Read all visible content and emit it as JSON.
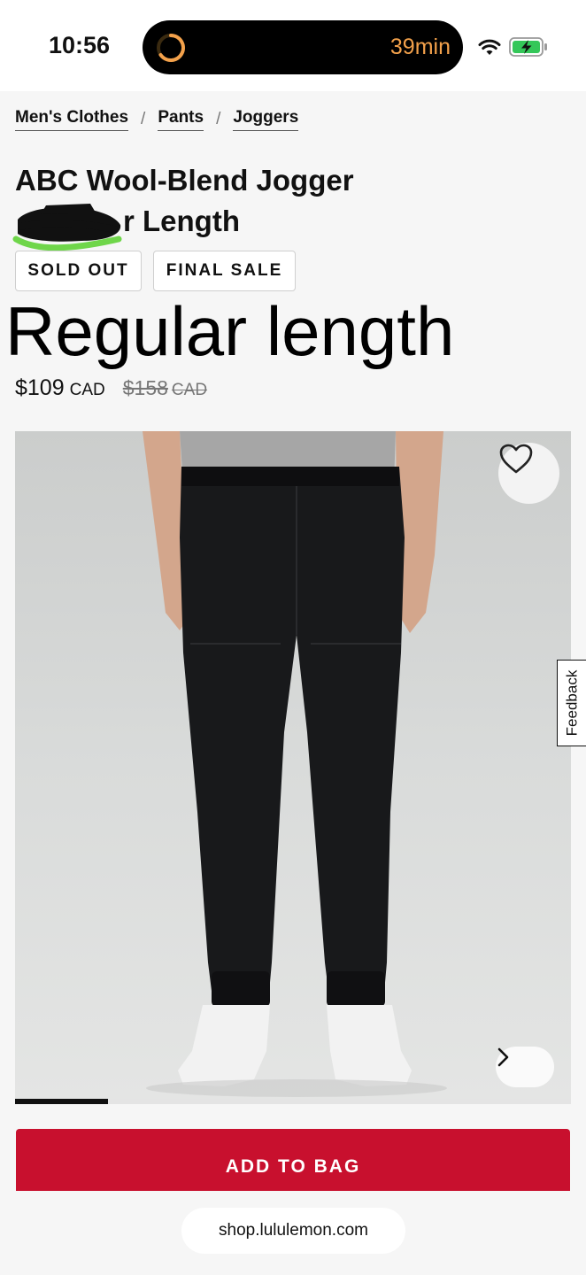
{
  "status_bar": {
    "time": "10:56",
    "activity_text": "39min",
    "activity_color": "#f3a14b",
    "icons": [
      "timer-icon",
      "wifi-icon",
      "battery-charging-icon"
    ]
  },
  "breadcrumb": {
    "items": [
      "Men's Clothes",
      "Pants",
      "Joggers"
    ],
    "separator": "/"
  },
  "product": {
    "title_line1": "ABC Wool-Blend Jogger",
    "title_line2": "r Length",
    "tags": [
      "SOLD OUT",
      "FINAL SALE"
    ],
    "annotation": "Regular length",
    "price": "$109",
    "price_currency": "CAD",
    "original_price": "$158",
    "original_currency": "CAD",
    "image_index": 1,
    "image_count": 6
  },
  "feedback_label": "Feedback",
  "add_to_bag_label": "ADD TO BAG",
  "url": "shop.lululemon.com",
  "colors": {
    "brand_red": "#c8102e",
    "background": "#f6f6f6"
  }
}
